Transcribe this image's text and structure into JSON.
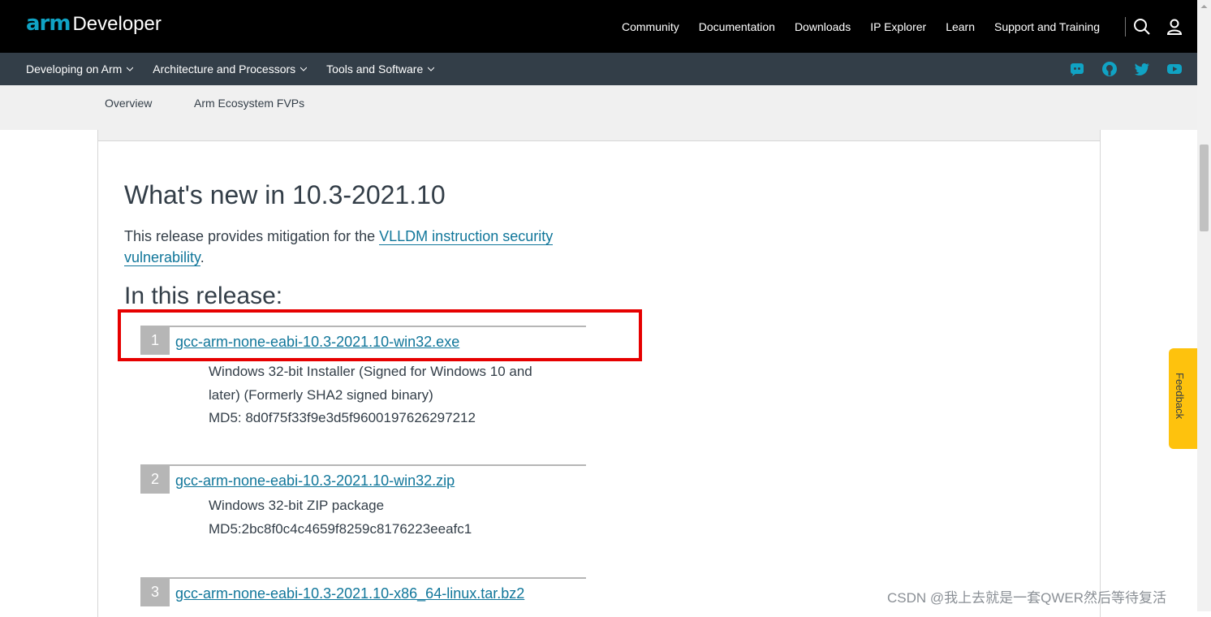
{
  "header": {
    "logo_arm": "arm",
    "logo_developer": "Developer",
    "nav": [
      "Community",
      "Documentation",
      "Downloads",
      "IP Explorer",
      "Learn",
      "Support and Training"
    ]
  },
  "subnav": {
    "items": [
      "Developing on Arm",
      "Architecture and Processors",
      "Tools and Software"
    ],
    "social_icons": [
      "discord-icon",
      "github-icon",
      "twitter-icon",
      "youtube-icon"
    ]
  },
  "tabs": [
    "Overview",
    "Arm Ecosystem FVPs"
  ],
  "main": {
    "title": "What's new in 10.3-2021.10",
    "intro_before": "This release provides mitigation for the ",
    "intro_link": "VLLDM instruction security vulnerability",
    "intro_after": ".",
    "release_heading": "In this release:",
    "releases": [
      {
        "number": "1",
        "file": "gcc-arm-none-eabi-10.3-2021.10-win32.exe",
        "desc1": "Windows 32-bit Installer (Signed for Windows 10 and later) (Formerly SHA2 signed binary)",
        "desc2": "MD5: 8d0f75f33f9e3d5f9600197626297212"
      },
      {
        "number": "2",
        "file": "gcc-arm-none-eabi-10.3-2021.10-win32.zip",
        "desc1": "Windows 32-bit ZIP package",
        "desc2": "MD5:2bc8f0c4c4659f8259c8176223eeafc1"
      },
      {
        "number": "3",
        "file": "gcc-arm-none-eabi-10.3-2021.10-x86_64-linux.tar.bz2",
        "desc1": "",
        "desc2": ""
      }
    ]
  },
  "feedback_label": "Feedback",
  "watermark": "CSDN @我上去就是一套QWER然后等待复活",
  "colors": {
    "accent": "#10a3c4",
    "link": "#10769a",
    "highlight": "#e60000",
    "feedback": "#fec20d"
  }
}
